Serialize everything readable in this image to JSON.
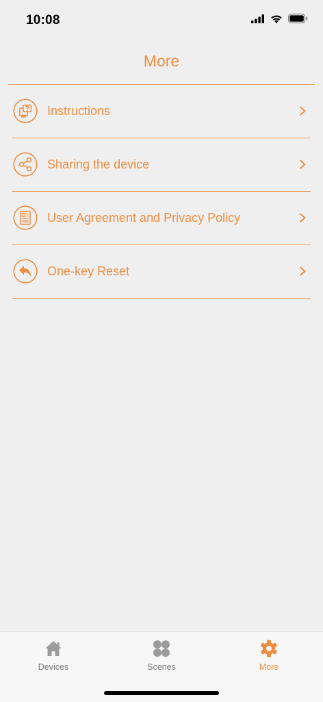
{
  "status_bar": {
    "time": "10:08"
  },
  "header": {
    "title": "More"
  },
  "menu": {
    "items": [
      {
        "label": "Instructions",
        "icon": "instructions-icon"
      },
      {
        "label": "Sharing the device",
        "icon": "share-icon"
      },
      {
        "label": "User Agreement and Privacy Policy",
        "icon": "document-icon"
      },
      {
        "label": "One-key Reset",
        "icon": "reset-icon"
      }
    ]
  },
  "tab_bar": {
    "tabs": [
      {
        "label": "Devices",
        "icon": "home-icon",
        "active": false
      },
      {
        "label": "Scenes",
        "icon": "scenes-icon",
        "active": false
      },
      {
        "label": "More",
        "icon": "gear-icon",
        "active": true
      }
    ]
  },
  "colors": {
    "accent": "#ee8e43",
    "divider": "#ee9a58",
    "inactive": "#7a7a7a",
    "background": "#efefef"
  }
}
